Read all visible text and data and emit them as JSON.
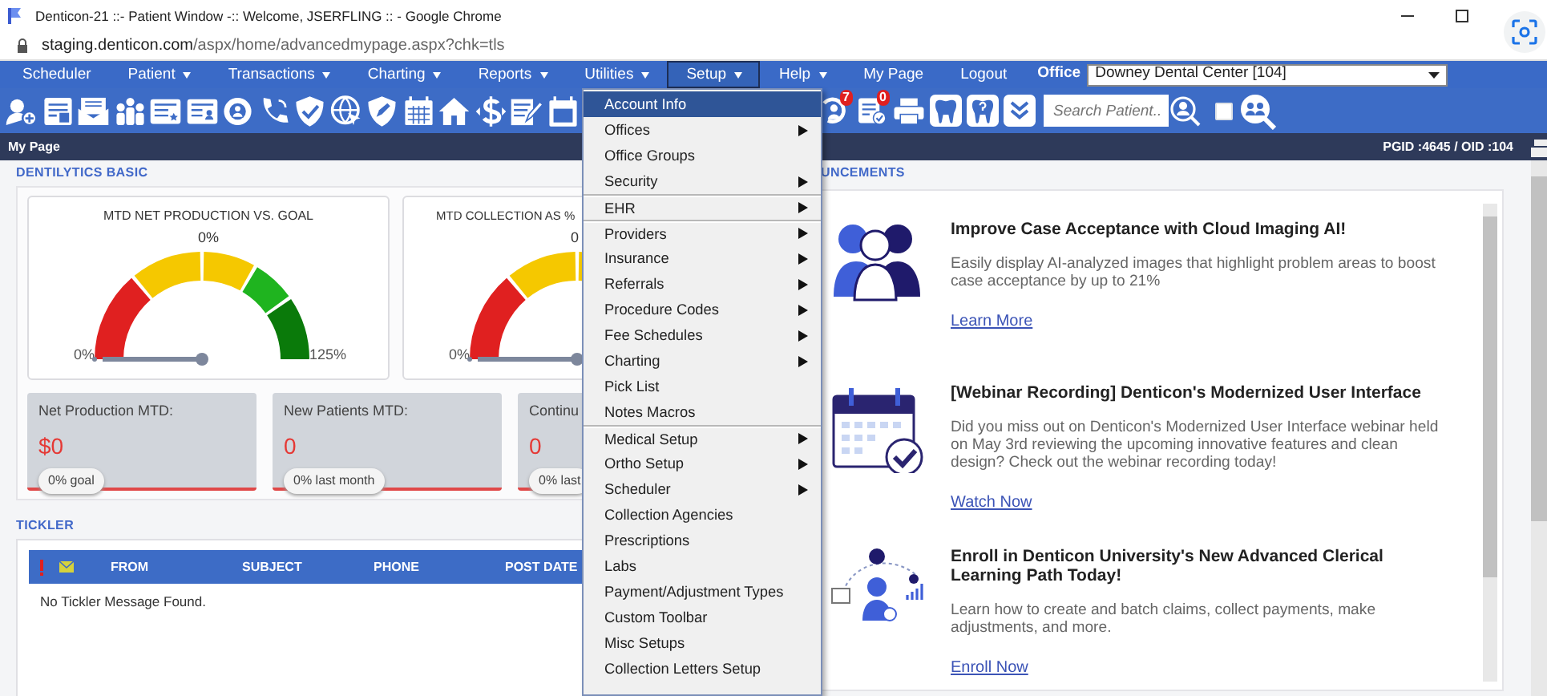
{
  "browser": {
    "title": "Denticon-21 ::- Patient Window -:: Welcome, JSERFLING :: - Google Chrome",
    "url_host": "staging.denticon.com",
    "url_path": "/aspx/home/advancedmypage.aspx?chk=tls"
  },
  "nav": {
    "items": [
      {
        "label": "Scheduler",
        "dropdown": false,
        "selected": false
      },
      {
        "label": "Patient",
        "dropdown": true,
        "selected": false
      },
      {
        "label": "Transactions",
        "dropdown": true,
        "selected": false
      },
      {
        "label": "Charting",
        "dropdown": true,
        "selected": false
      },
      {
        "label": "Reports",
        "dropdown": true,
        "selected": false
      },
      {
        "label": "Utilities",
        "dropdown": true,
        "selected": false
      },
      {
        "label": "Setup",
        "dropdown": true,
        "selected": true
      },
      {
        "label": "Help",
        "dropdown": true,
        "selected": false
      },
      {
        "label": "My Page",
        "dropdown": false,
        "selected": false
      },
      {
        "label": "Logout",
        "dropdown": false,
        "selected": false
      }
    ],
    "office_label": "Office",
    "office_value": "Downey Dental Center [104]"
  },
  "toolbar": {
    "reminder_badge": "7",
    "task_badge": "0",
    "search": {
      "placeholder": "Search Patient..."
    },
    "group_search_checked": false
  },
  "page_bar": {
    "title": "My Page",
    "ids": "PGID :4645 / OID :104"
  },
  "dentilytics": {
    "heading": "DENTILYTICS BASIC",
    "gauges": [
      {
        "title": "MTD NET PRODUCTION VS. GOAL",
        "value": "0%",
        "min": "0%",
        "max": "125%",
        "level": 0
      },
      {
        "title": "MTD COLLECTION AS %",
        "value": "0",
        "min": "0%",
        "level": 0
      }
    ],
    "stats": [
      {
        "label": "Net Production MTD:",
        "value": "$0",
        "note": "0% goal"
      },
      {
        "label": "New Patients MTD:",
        "value": "0",
        "note": "0% last month"
      },
      {
        "label": "Continu",
        "value": "0",
        "note": "0% last"
      }
    ]
  },
  "tickler": {
    "heading": "TICKLER",
    "columns": [
      "FROM",
      "SUBJECT",
      "PHONE",
      "POST DATE"
    ],
    "empty_message": "No Tickler Message Found."
  },
  "announcements": {
    "heading": "UNCEMENTS",
    "items": [
      {
        "kind": "people",
        "title": "Improve Case Acceptance with Cloud Imaging AI!",
        "body": "Easily display AI-analyzed images that highlight problem areas to boost case acceptance by up to 21%",
        "link": "Learn More"
      },
      {
        "kind": "calendar",
        "title": "[Webinar Recording] Denticon's Modernized User Interface",
        "body": "Did you miss out on Denticon's Modernized User Interface webinar held on May 3rd reviewing the upcoming innovative features and clean design? Check out the webinar recording today!",
        "link": "Watch Now"
      },
      {
        "kind": "learning",
        "title": "Enroll in Denticon University's New Advanced Clerical Learning Path Today!",
        "body": "Learn how to create and batch claims, collect payments, make adjustments, and more.",
        "link": "Enroll Now"
      }
    ]
  },
  "setup_menu": {
    "items": [
      {
        "label": "Account Info",
        "submenu": false,
        "selected": true,
        "separator_before": false
      },
      {
        "label": "Offices",
        "submenu": true,
        "selected": false,
        "separator_before": false
      },
      {
        "label": "Office Groups",
        "submenu": false,
        "selected": false,
        "separator_before": false
      },
      {
        "label": "Security",
        "submenu": true,
        "selected": false,
        "separator_before": false
      },
      {
        "label": "EHR",
        "submenu": true,
        "selected": false,
        "separator_before": true
      },
      {
        "label": "Providers",
        "submenu": true,
        "selected": false,
        "separator_before": true
      },
      {
        "label": "Insurance",
        "submenu": true,
        "selected": false,
        "separator_before": false
      },
      {
        "label": "Referrals",
        "submenu": true,
        "selected": false,
        "separator_before": false
      },
      {
        "label": "Procedure Codes",
        "submenu": true,
        "selected": false,
        "separator_before": false
      },
      {
        "label": "Fee Schedules",
        "submenu": true,
        "selected": false,
        "separator_before": false
      },
      {
        "label": "Charting",
        "submenu": true,
        "selected": false,
        "separator_before": false
      },
      {
        "label": "Pick List",
        "submenu": false,
        "selected": false,
        "separator_before": false
      },
      {
        "label": "Notes Macros",
        "submenu": false,
        "selected": false,
        "separator_before": false
      },
      {
        "label": "Medical Setup",
        "submenu": true,
        "selected": false,
        "separator_before": true
      },
      {
        "label": "Ortho Setup",
        "submenu": true,
        "selected": false,
        "separator_before": false
      },
      {
        "label": "Scheduler",
        "submenu": true,
        "selected": false,
        "separator_before": false
      },
      {
        "label": "Collection Agencies",
        "submenu": false,
        "selected": false,
        "separator_before": false
      },
      {
        "label": "Prescriptions",
        "submenu": false,
        "selected": false,
        "separator_before": false
      },
      {
        "label": "Labs",
        "submenu": false,
        "selected": false,
        "separator_before": false
      },
      {
        "label": "Payment/Adjustment Types",
        "submenu": false,
        "selected": false,
        "separator_before": false
      },
      {
        "label": "Custom Toolbar",
        "submenu": false,
        "selected": false,
        "separator_before": false
      },
      {
        "label": "Misc Setups",
        "submenu": false,
        "selected": false,
        "separator_before": false
      },
      {
        "label": "Collection Letters Setup",
        "submenu": false,
        "selected": false,
        "separator_before": false
      }
    ]
  }
}
